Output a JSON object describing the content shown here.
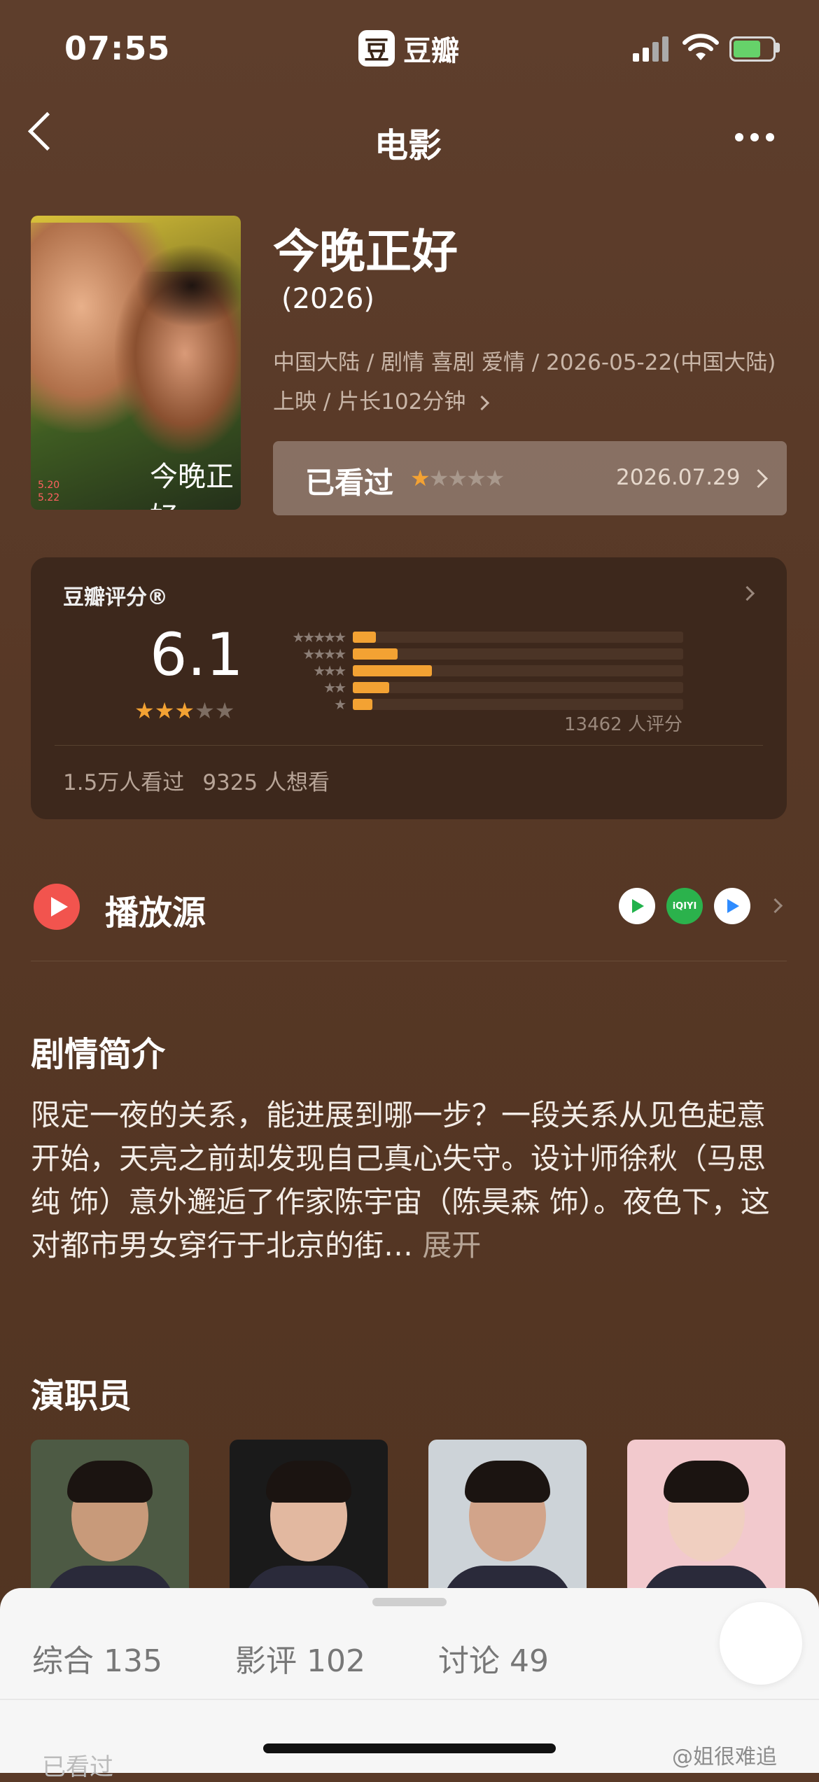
{
  "status_bar": {
    "time": "07:55",
    "brand_logo": "豆",
    "brand_name": "豆瓣"
  },
  "nav": {
    "title": "电影"
  },
  "movie": {
    "poster_title": "今晚正好",
    "poster_date": "5.20\n5.22",
    "title": "今晚正好",
    "year": "(2026)",
    "meta": "中国大陆 / 剧情 喜剧 爱情 / 2026-05-22(中国大陆) 上映 / 片长102分钟",
    "watched_label": "已看过",
    "watched_stars": 1,
    "watched_date": "2026.07.29"
  },
  "rating": {
    "heading": "豆瓣评分®",
    "score": "6.1",
    "score_stars": 3,
    "distribution": [
      {
        "stars": 5,
        "fraction": 0.07
      },
      {
        "stars": 4,
        "fraction": 0.135
      },
      {
        "stars": 3,
        "fraction": 0.24
      },
      {
        "stars": 2,
        "fraction": 0.11
      },
      {
        "stars": 1,
        "fraction": 0.06
      }
    ],
    "count_text": "13462 人评分",
    "watched_text": "1.5万人看过",
    "want_text": "9325 人想看"
  },
  "play_sources": {
    "label": "播放源",
    "sources": [
      {
        "icon": "tencent-video-icon",
        "color": "#21b24b"
      },
      {
        "icon": "iqiyi-icon",
        "color": "#2bb24c",
        "text": "iQIYI"
      },
      {
        "icon": "youku-icon",
        "color": "#2f8cff"
      }
    ]
  },
  "synopsis": {
    "title": "剧情简介",
    "text": "限定一夜的关系，能进展到哪一步？一段关系从见色起意开始，天亮之前却发现自己真心失守。设计师徐秋（马思纯 饰）意外邂逅了作家陈宇宙（陈昊森 饰）。夜色下，这对都市男女穿行于北京的街…",
    "more": "展开"
  },
  "cast": {
    "title": "演职员",
    "members": [
      {
        "bg": "#4d5a44",
        "skin": "#c89a7a",
        "icon": "cast-photo-1"
      },
      {
        "bg": "#1a1a1a",
        "skin": "#e2b8a0",
        "icon": "cast-photo-2"
      },
      {
        "bg": "#cdd3d8",
        "skin": "#d2a48a",
        "icon": "cast-photo-3"
      },
      {
        "bg": "#f2c9cd",
        "skin": "#f0cfc0",
        "icon": "cast-photo-4"
      }
    ]
  },
  "sheet": {
    "tabs": [
      "综合 135",
      "影评 102",
      "讨论 49"
    ],
    "peek": "已看过"
  },
  "watermark": "@姐很难追"
}
